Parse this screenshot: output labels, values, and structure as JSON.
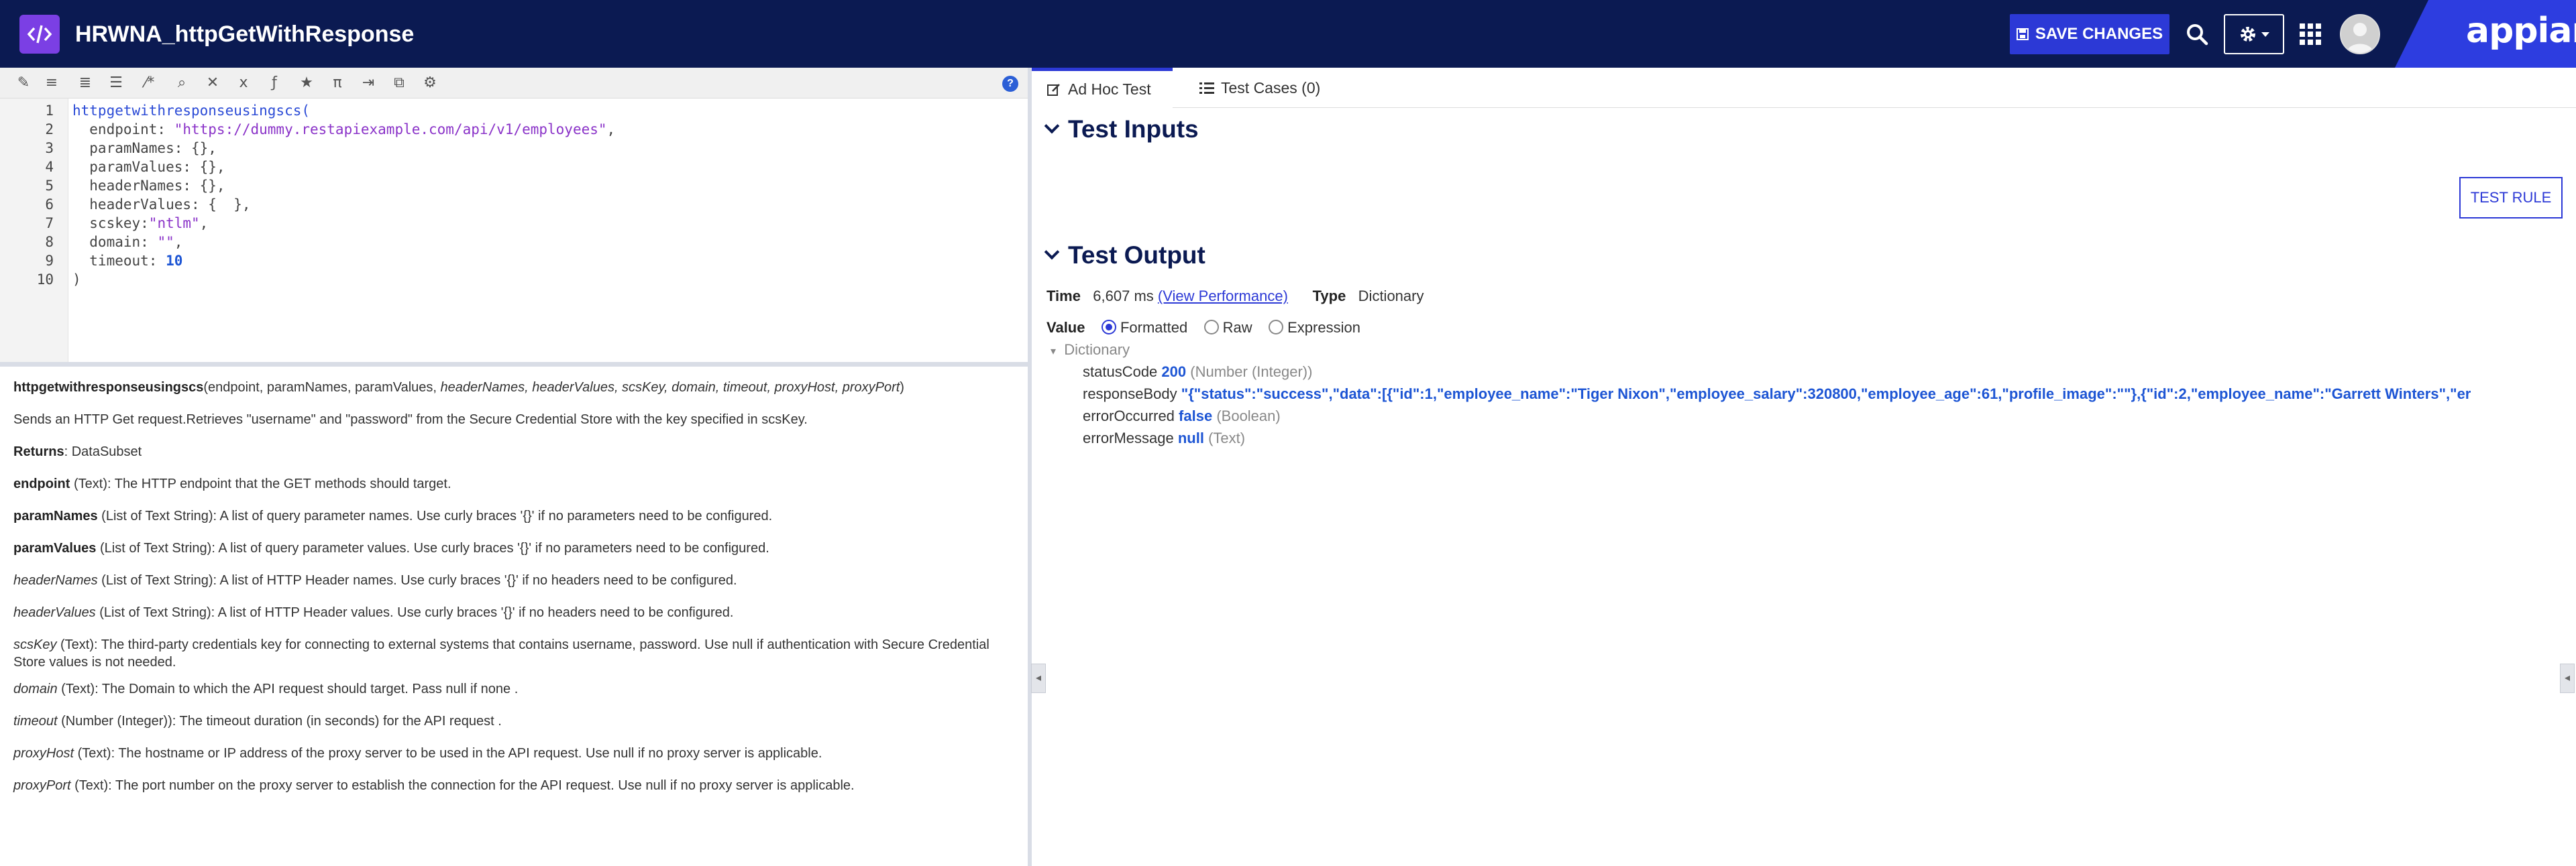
{
  "header": {
    "title": "HRWNA_httpGetWithResponse",
    "save_label": "SAVE CHANGES",
    "brand": "appian",
    "accent": "#2c39d6",
    "bg": "#0b1a52",
    "icons": [
      "code-icon",
      "save-icon",
      "search-icon",
      "gear-icon",
      "apps-grid-icon",
      "avatar"
    ]
  },
  "editor": {
    "line_numbers": [
      "1",
      "2",
      "3",
      "4",
      "5",
      "6",
      "7",
      "8",
      "9",
      "10"
    ],
    "lines": {
      "l1": "httpgetwithresponseusingscs(",
      "l2_key": "  endpoint: ",
      "l2_val": "\"https://dummy.restapiexample.com/api/v1/employees\"",
      "l2_end": ",",
      "l3": "  paramNames: {},",
      "l4": "  paramValues: {},",
      "l5": "  headerNames: {},",
      "l6": "  headerValues: {  },",
      "l7_key": "  scskey:",
      "l7_val": "\"ntlm\"",
      "l7_end": ",",
      "l8_key": "  domain: ",
      "l8_val": "\"\"",
      "l8_end": ",",
      "l9_key": "  timeout: ",
      "l9_val": "10",
      "l10": ")"
    }
  },
  "doc": {
    "signature_fn": "httpgetwithresponseusingscs",
    "signature_args": "(endpoint, paramNames, paramValues, ",
    "signature_opt": "headerNames, headerValues, scsKey, domain, timeout, proxyHost, proxyPort",
    "signature_end": ")",
    "description": "Sends an HTTP Get request.Retrieves \"username\" and \"password\" from the Secure Credential Store with the key specified in scsKey.",
    "returns_label": "Returns",
    "returns_value": ": DataSubset",
    "params": [
      {
        "name": "endpoint",
        "desc": " (Text): The HTTP endpoint that the GET methods should target."
      },
      {
        "name": "paramNames",
        "desc": " (List of Text String): A list of query parameter names. Use curly braces '{}' if no parameters need to be configured."
      },
      {
        "name": "paramValues",
        "desc": " (List of Text String): A list of query parameter values. Use curly braces '{}' if no parameters need to be configured."
      },
      {
        "name": "headerNames",
        "desc": " (List of Text String): A list of HTTP Header names. Use curly braces '{}' if no headers need to be configured."
      },
      {
        "name": "headerValues",
        "desc": " (List of Text String): A list of HTTP Header values. Use curly braces '{}' if no headers need to be configured."
      },
      {
        "name": "scsKey",
        "desc": " (Text): The third-party credentials key for connecting to external systems that contains username, password. Use null if authentication with Secure Credential Store values is not needed."
      },
      {
        "name": "domain",
        "desc": " (Text): The Domain to which the API request should target. Pass null if none ."
      },
      {
        "name": "timeout",
        "desc": " (Number (Integer)): The timeout duration (in seconds) for the API request ."
      },
      {
        "name": "proxyHost",
        "desc": " (Text): The hostname or IP address of the proxy server to be used in the API request. Use null if no proxy server is applicable."
      },
      {
        "name": "proxyPort",
        "desc": " (Text): The port number on the proxy server to establish the connection for the API request. Use null if no proxy server is applicable."
      }
    ]
  },
  "tabs": [
    {
      "label": "Ad Hoc Test"
    },
    {
      "label": "Test Cases (0)"
    }
  ],
  "test": {
    "inputs_title": "Test Inputs",
    "output_title": "Test Output",
    "run_label": "TEST RULE",
    "time_label": "Time",
    "time_value": "6,607 ms",
    "perf_link": "(View Performance)",
    "type_label": "Type",
    "type_value": "Dictionary",
    "value_label": "Value",
    "value_modes": [
      "Formatted",
      "Raw",
      "Expression"
    ],
    "value_mode_selected": "Formatted",
    "dict_label": "Dictionary",
    "fields": {
      "status_key": "statusCode",
      "status_val": "200",
      "status_type": "(Number (Integer))",
      "body_key": "responseBody",
      "body_val": "\"{\"status\":\"success\",\"data\":[{\"id\":1,\"employee_name\":\"Tiger Nixon\",\"employee_salary\":320800,\"employee_age\":61,\"profile_image\":\"\"},{\"id\":2,\"employee_name\":\"Garrett Winters\",\"er",
      "err_key": "errorOccurred",
      "err_val": "false",
      "err_type": "(Boolean)",
      "msg_key": "errorMessage",
      "msg_val": "null",
      "msg_type": "(Text)"
    }
  }
}
